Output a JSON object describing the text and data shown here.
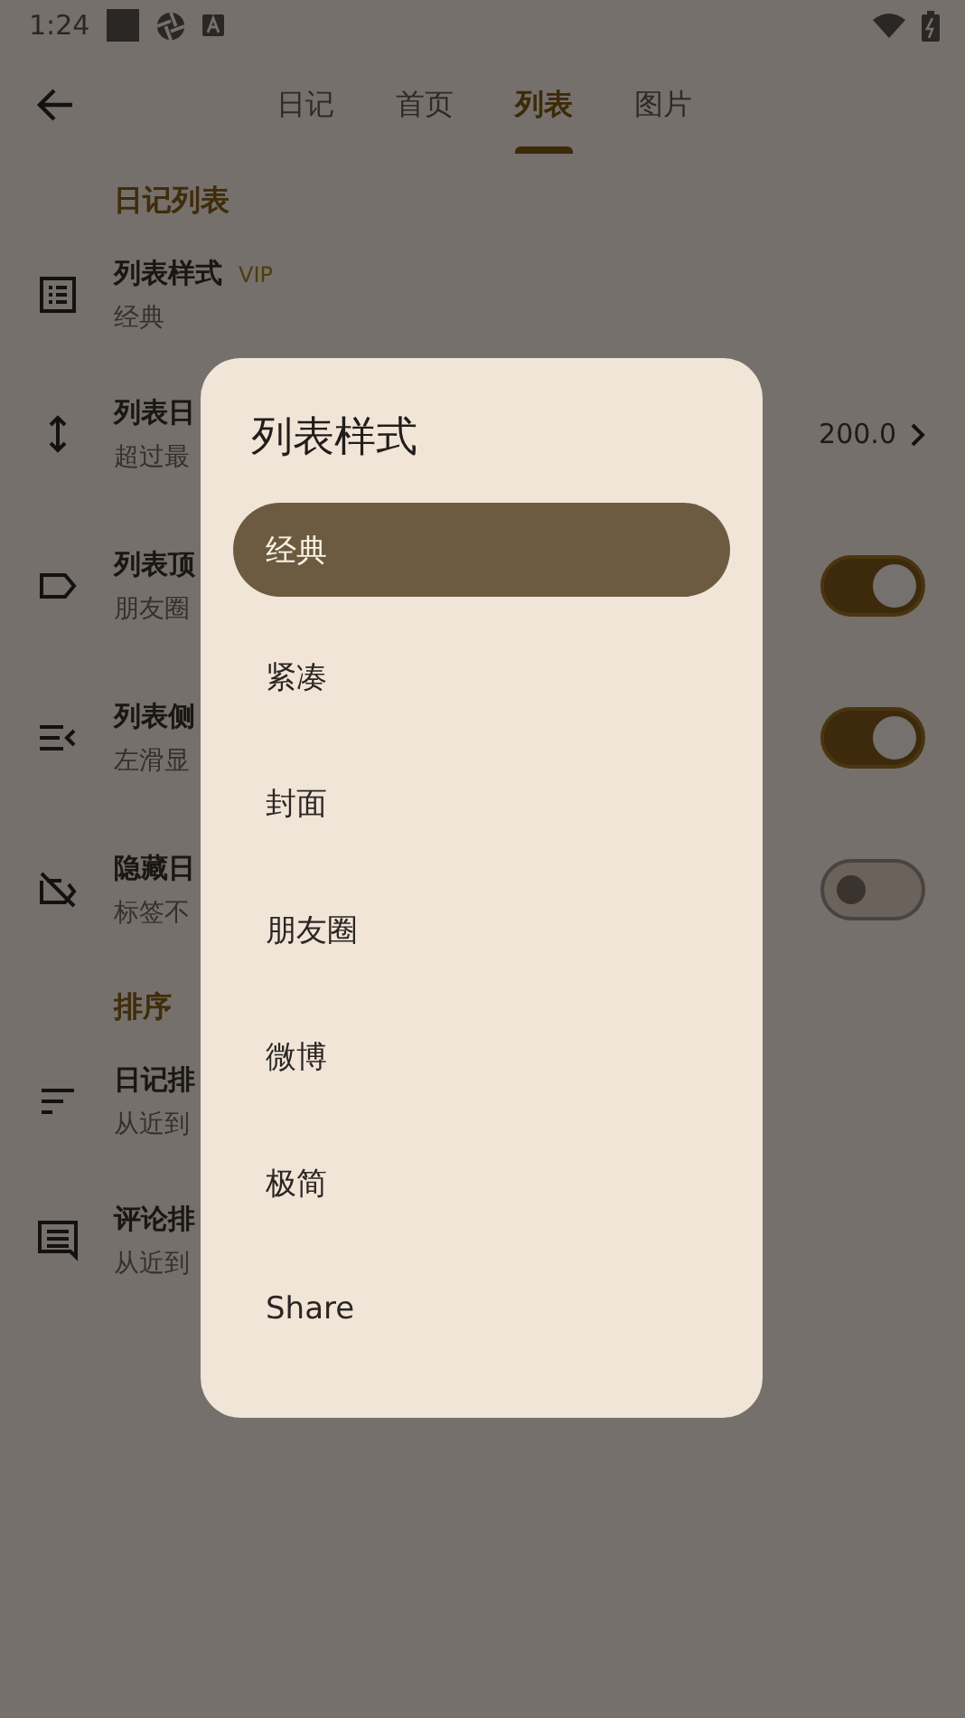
{
  "status_bar": {
    "time": "1:24"
  },
  "nav": {
    "tabs": [
      {
        "label": "日记",
        "selected": false
      },
      {
        "label": "首页",
        "selected": false
      },
      {
        "label": "列表",
        "selected": true
      },
      {
        "label": "图片",
        "selected": false
      }
    ]
  },
  "sections": [
    {
      "title": "日记列表",
      "rows": [
        {
          "kind": "plain",
          "title": "列表样式",
          "badge": "VIP",
          "subtitle": "经典"
        },
        {
          "kind": "value",
          "title": "列表日",
          "subtitle": "超过最",
          "value": "200.0"
        },
        {
          "kind": "toggle",
          "title": "列表顶",
          "subtitle": "朋友圈",
          "on": true
        },
        {
          "kind": "toggle",
          "title": "列表侧",
          "subtitle": "左滑显",
          "on": true
        },
        {
          "kind": "toggle",
          "title": "隐藏日",
          "subtitle": "标签不",
          "on": false
        }
      ]
    },
    {
      "title": "排序",
      "rows": [
        {
          "kind": "plain",
          "title": "日记排",
          "subtitle": "从近到"
        },
        {
          "kind": "plain",
          "title": "评论排",
          "subtitle": "从近到"
        }
      ]
    }
  ],
  "dialog": {
    "title": "列表样式",
    "options": [
      {
        "label": "经典",
        "selected": true
      },
      {
        "label": "紧凑",
        "selected": false
      },
      {
        "label": "封面",
        "selected": false
      },
      {
        "label": "朋友圈",
        "selected": false
      },
      {
        "label": "微博",
        "selected": false
      },
      {
        "label": "极简",
        "selected": false
      },
      {
        "label": "Share",
        "selected": false
      }
    ]
  }
}
